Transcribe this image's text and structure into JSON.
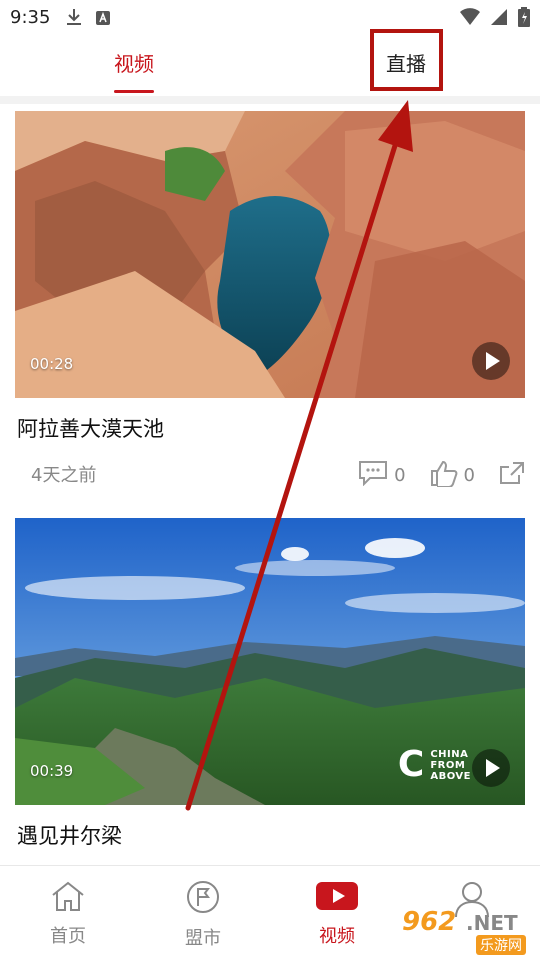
{
  "status": {
    "time": "9:35",
    "icons": [
      "download-icon",
      "app-notification-icon",
      "wifi-icon",
      "signal-icon",
      "battery-charging-icon"
    ]
  },
  "top_tabs": [
    {
      "label": "视频",
      "active": true
    },
    {
      "label": "直播",
      "active": false
    }
  ],
  "feed": [
    {
      "title": "阿拉善大漠天池",
      "duration": "00:28",
      "time": "4天之前",
      "comments": "0",
      "likes": "0"
    },
    {
      "title": "遇见井尔梁",
      "duration": "00:39",
      "watermark": [
        "CHINA",
        "FROM",
        "ABOVE"
      ]
    }
  ],
  "bottom_nav": [
    {
      "label": "首页",
      "icon": "home-icon"
    },
    {
      "label": "盟市",
      "icon": "flag-icon"
    },
    {
      "label": "视频",
      "icon": "video-play-icon",
      "active": true
    },
    {
      "label": "",
      "icon": "profile-icon"
    }
  ],
  "site_watermark": {
    "number": "962",
    "suffix": ".NET",
    "name": "乐游网"
  },
  "colors": {
    "accent": "#c8161d",
    "annotation": "#b3140f"
  }
}
